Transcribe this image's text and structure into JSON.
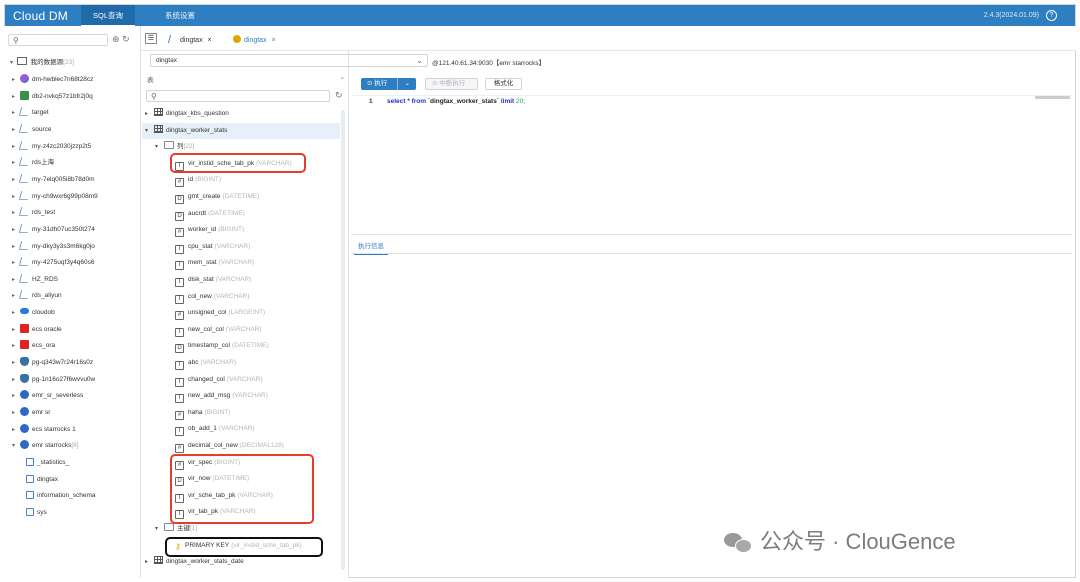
{
  "app": {
    "logo": "Cloud DM",
    "nav": [
      "SQL查询",
      "系统设置"
    ],
    "version": "2.4.3(2024.01.09)",
    "help_glyph": "?"
  },
  "left_panel": {
    "search_placeholder": "",
    "root_label": "我的数据源",
    "root_count": "[23]",
    "items": [
      {
        "label": "dm-hwblec7n68t28cz",
        "icon": "greenplum-icon",
        "expanded": false
      },
      {
        "label": "db2-nvkq57z1bfr2j0q",
        "icon": "db2-icon",
        "expanded": false
      },
      {
        "label": "target",
        "icon": "mysql-icon",
        "expanded": false
      },
      {
        "label": "source",
        "icon": "mysql-icon",
        "expanded": false
      },
      {
        "label": "my-z4zc2030jzzp2t5",
        "icon": "mysql-icon",
        "expanded": false
      },
      {
        "label": "rds上海",
        "icon": "mysql-icon",
        "expanded": false
      },
      {
        "label": "my-7elq005i8b78d0m",
        "icon": "mysql-icon",
        "expanded": false
      },
      {
        "label": "my-ch9wxr6g99p08m9",
        "icon": "mysql-icon",
        "expanded": false
      },
      {
        "label": "rds_test",
        "icon": "mysql-icon",
        "expanded": false
      },
      {
        "label": "my-31dh07uc350t274",
        "icon": "mysql-icon",
        "expanded": false
      },
      {
        "label": "my-dky3y3s3m6kg0jo",
        "icon": "mysql-icon",
        "expanded": false
      },
      {
        "label": "my-4275uqf3y4q60s6",
        "icon": "mysql-icon",
        "expanded": false
      },
      {
        "label": "HZ_RDS",
        "icon": "mysql-icon",
        "expanded": false
      },
      {
        "label": "rds_aliyun",
        "icon": "mysql-icon",
        "expanded": false
      },
      {
        "label": "cloudob",
        "icon": "oceanbase-icon",
        "expanded": false
      },
      {
        "label": "ecs oracle",
        "icon": "oracle-icon",
        "expanded": false
      },
      {
        "label": "ecs_ora",
        "icon": "oracle-icon",
        "expanded": false
      },
      {
        "label": "pg-q343w7r24r16s0z",
        "icon": "postgres-icon",
        "expanded": false
      },
      {
        "label": "pg-1n16o27f6wvvu0w",
        "icon": "postgres-icon",
        "expanded": false
      },
      {
        "label": "emr_sr_severless",
        "icon": "starrocks-icon",
        "expanded": false
      },
      {
        "label": "emr sr",
        "icon": "starrocks-icon",
        "expanded": false
      },
      {
        "label": "ecs starrocks 1",
        "icon": "starrocks-icon",
        "expanded": false
      },
      {
        "label": "emr starrocks",
        "icon": "starrocks-icon",
        "expanded": true,
        "count": "[8]"
      }
    ],
    "schemas": [
      "_statistics_",
      "dingtax",
      "information_schema",
      "sys"
    ]
  },
  "tabs": [
    {
      "label": "dingtax",
      "close": "×",
      "active": false
    },
    {
      "label": "dingtax",
      "close": "×",
      "active": true
    }
  ],
  "object_panel": {
    "database": "dingtax",
    "connection": "@121.40.61.34:9030【emr starrocks】",
    "section_label": "表",
    "search_placeholder": "",
    "tables_before": [
      "dingtax_kbs_question"
    ],
    "selected_table": "dingtax_worker_stats",
    "columns_folder": "列",
    "columns_count": "[22]",
    "columns": [
      {
        "name": "vir_instid_sche_tab_pk",
        "type": "(VARCHAR)",
        "icon": "T"
      },
      {
        "name": "id",
        "type": "(BIGINT)",
        "icon": "#"
      },
      {
        "name": "gmt_create",
        "type": "(DATETIME)",
        "icon": "D"
      },
      {
        "name": "aucrdt",
        "type": "(DATETIME)",
        "icon": "D"
      },
      {
        "name": "worker_id",
        "type": "(BIGINT)",
        "icon": "#"
      },
      {
        "name": "cpu_stat",
        "type": "(VARCHAR)",
        "icon": "T"
      },
      {
        "name": "mem_stat",
        "type": "(VARCHAR)",
        "icon": "T"
      },
      {
        "name": "disk_stat",
        "type": "(VARCHAR)",
        "icon": "T"
      },
      {
        "name": "col_new",
        "type": "(VARCHAR)",
        "icon": "T"
      },
      {
        "name": "unsigned_col",
        "type": "(LARGEINT)",
        "icon": "#"
      },
      {
        "name": "new_col_col",
        "type": "(VARCHAR)",
        "icon": "T"
      },
      {
        "name": "timestamp_col",
        "type": "(DATETIME)",
        "icon": "D"
      },
      {
        "name": "abc",
        "type": "(VARCHAR)",
        "icon": "T"
      },
      {
        "name": "changed_col",
        "type": "(VARCHAR)",
        "icon": "T"
      },
      {
        "name": "new_add_msg",
        "type": "(VARCHAR)",
        "icon": "T"
      },
      {
        "name": "haha",
        "type": "(BIGINT)",
        "icon": "#"
      },
      {
        "name": "ob_add_1",
        "type": "(VARCHAR)",
        "icon": "T"
      },
      {
        "name": "decimal_col_new",
        "type": "(DECIMAL128)",
        "icon": "#"
      },
      {
        "name": "vir_spec",
        "type": "(BIGINT)",
        "icon": "#"
      },
      {
        "name": "vir_now",
        "type": "(DATETIME)",
        "icon": "D"
      },
      {
        "name": "vir_sche_tab_pk",
        "type": "(VARCHAR)",
        "icon": "T"
      },
      {
        "name": "vir_tab_pk",
        "type": "(VARCHAR)",
        "icon": "T"
      }
    ],
    "pk_folder": "主键",
    "pk_count": "[1]",
    "pk_label": "PRIMARY KEY",
    "pk_cols": "(vir_instid_sche_tab_pk)",
    "tables_after": [
      "dingtax_worker_stats_date"
    ]
  },
  "editor": {
    "run_label": "执行",
    "stop_label": "中断执行",
    "format_label": "格式化",
    "line_number": "1",
    "sql_select": "select",
    "sql_star_from": "* from",
    "sql_table": "`dingtax_worker_stats`",
    "sql_limit": "limit",
    "sql_num": "20",
    "sql_end": ";",
    "result_tab": "执行信息"
  },
  "watermark": "公众号 · ClouGence"
}
